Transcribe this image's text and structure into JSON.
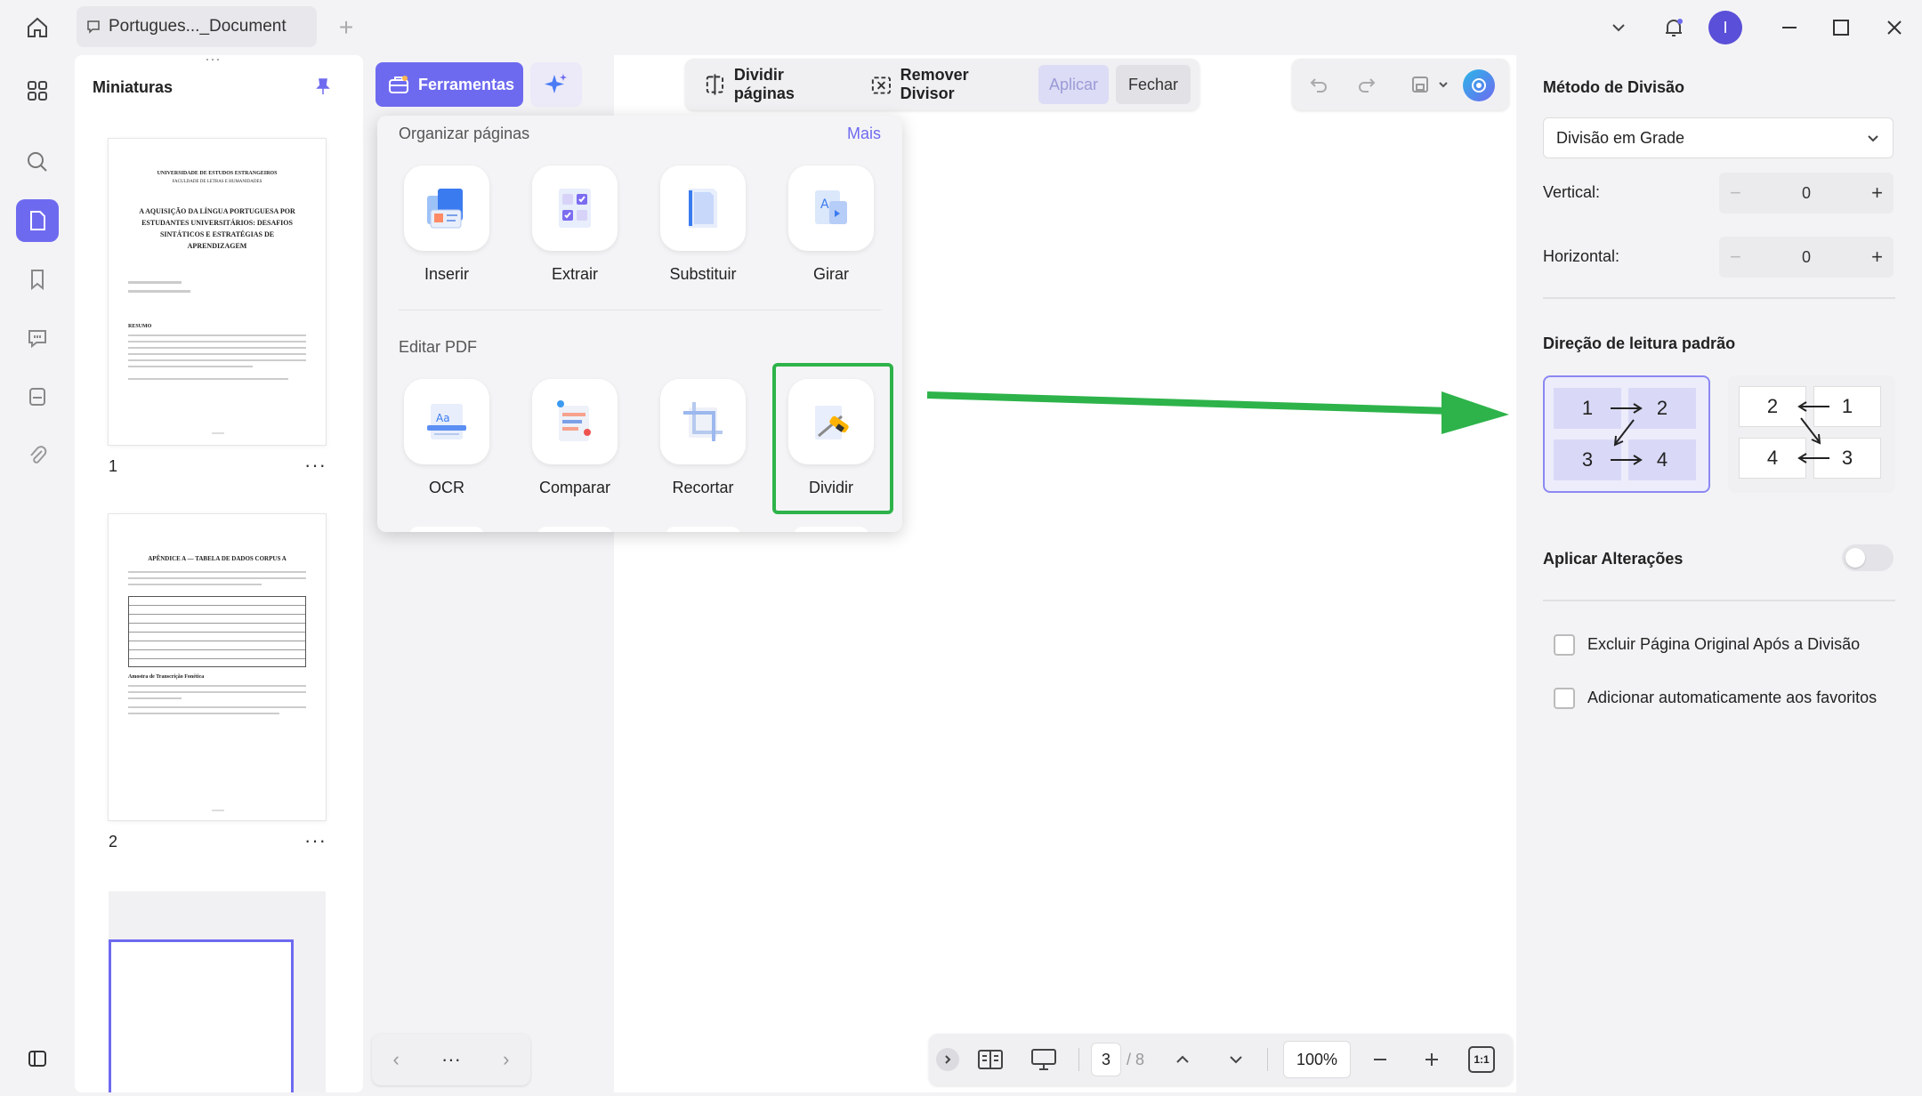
{
  "titlebar": {
    "tab_title": "Portugues..._Document",
    "avatar_letter": "I",
    "colors": {
      "accent": "#6e6af0",
      "avatar": "#5a4fd8"
    }
  },
  "thumbnails": {
    "title": "Miniaturas",
    "pages": [
      {
        "number": "1",
        "lines": [
          "UNIVERSIDADE DE ESTUDOS ESTRANGEIROS",
          "FACULDADE DE LETRAS E HUMANIDADES",
          "A AQUISIÇÃO DA LÍNGUA PORTUGUESA POR",
          "ESTUDANTES UNIVERSITÁRIOS: DESAFIOS",
          "SINTÁTICOS E ESTRATÉGIAS DE",
          "APRENDIZAGEM",
          "RESUMO"
        ]
      },
      {
        "number": "2",
        "lines": [
          "APÊNDICE A — TABELA DE DADOS CORPUS A",
          "Amostra de Transcrição Fonética"
        ]
      }
    ],
    "more": "···"
  },
  "toolbar": {
    "tools_label": "Ferramentas",
    "split_pages": "Dividir páginas",
    "remove_divider": "Remover Divisor",
    "apply": "Aplicar",
    "close": "Fechar"
  },
  "popup": {
    "section1": "Organizar páginas",
    "more": "Mais",
    "section2": "Editar PDF",
    "tools1": [
      "Inserir",
      "Extrair",
      "Substituir",
      "Girar"
    ],
    "tools2": [
      "OCR",
      "Comparar",
      "Recortar",
      "Dividir"
    ]
  },
  "panel": {
    "method_title": "Método de Divisão",
    "method_value": "Divisão em Grade",
    "vertical_label": "Vertical:",
    "vertical_value": "0",
    "horizontal_label": "Horizontal:",
    "horizontal_value": "0",
    "reading_dir_title": "Direção de leitura padrão",
    "dir_a": [
      "1",
      "2",
      "3",
      "4"
    ],
    "dir_b": [
      "2",
      "1",
      "4",
      "3"
    ],
    "apply_changes": "Aplicar Alterações",
    "opt_delete": "Excluir Página Original Após a Divisão",
    "opt_favorites": "Adicionar automaticamente aos favoritos"
  },
  "bottom": {
    "nav_more": "···",
    "page_current": "3",
    "page_total": "/ 8",
    "zoom": "100%",
    "fit": "1:1"
  },
  "annotation_color": "#2db34a"
}
